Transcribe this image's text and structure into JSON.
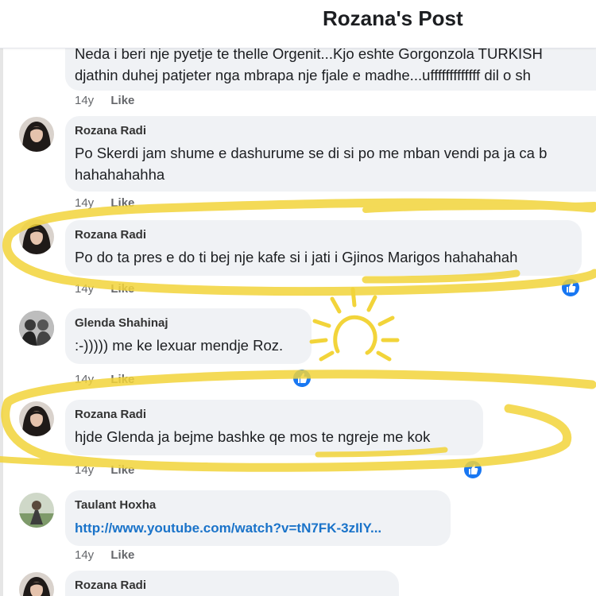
{
  "header": {
    "title": "Rozana's Post"
  },
  "comments": [
    {
      "author": "",
      "lines": [
        "Neda i beri nje pyetje te thelle Orgenit...Kjo eshte Gorgonzola TURKISH",
        "djathin duhej patjeter nga mbrapa nje fjale e madhe...ufffffffffffff dil o sh"
      ],
      "time": "14y",
      "like": "Like"
    },
    {
      "author": "Rozana Radi",
      "lines": [
        "Po Skerdi jam shume e dashurume se di si po me mban vendi pa ja ca b",
        "hahahahahha"
      ],
      "time": "14y",
      "like": "Like"
    },
    {
      "author": "Rozana Radi",
      "lines": [
        "Po do ta pres e do ti bej nje kafe si i jati i Gjinos Marigos hahahahah"
      ],
      "time": "14y",
      "like": "Like"
    },
    {
      "author": "Glenda Shahinaj",
      "lines": [
        ":-))))) me ke lexuar mendje Roz."
      ],
      "time": "14y",
      "like": "Like"
    },
    {
      "author": "Rozana Radi",
      "lines": [
        "hjde Glenda ja bejme bashke qe mos te ngreje me kok"
      ],
      "time": "14y",
      "like": "Like"
    },
    {
      "author": "Taulant Hoxha",
      "lines": [
        "http://www.youtube.com/watch?v=tN7FK-3zIlY..."
      ],
      "time": "14y",
      "like": "Like"
    },
    {
      "author": "Rozana Radi",
      "lines": [],
      "time": "",
      "like": ""
    }
  ],
  "colors": {
    "bubble": "#f0f2f5",
    "like_blue": "#1877f2",
    "link": "#1a73c9",
    "highlight": "#f2d43a"
  },
  "icons": [
    "thumbs-up-icon",
    "sun-doodle-icon"
  ]
}
